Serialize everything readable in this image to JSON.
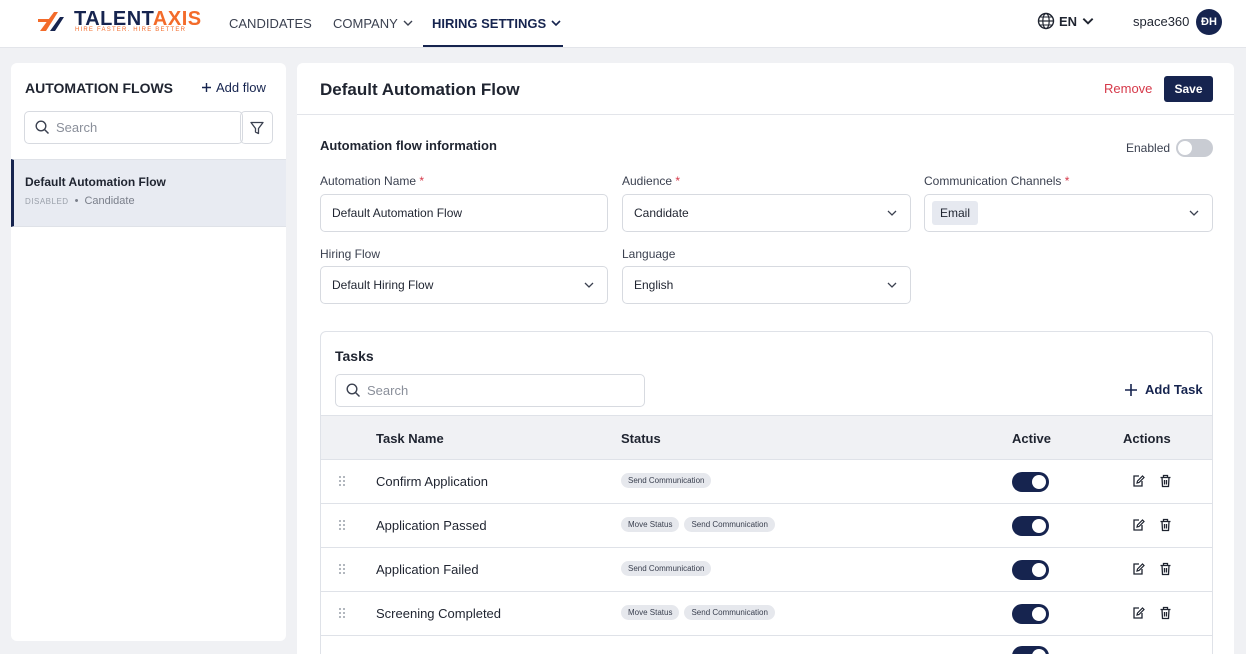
{
  "brand": {
    "name_dark": "TALENT",
    "name_accent": "AXIS",
    "tagline": "HIRE FASTER. HIRE BETTER"
  },
  "nav": {
    "items": [
      {
        "label": "CANDIDATES",
        "has_dropdown": false,
        "active": false
      },
      {
        "label": "COMPANY",
        "has_dropdown": true,
        "active": false
      },
      {
        "label": "HIRING SETTINGS",
        "has_dropdown": true,
        "active": true
      }
    ],
    "language": "EN",
    "username": "space360",
    "avatar_initials": "ĐH"
  },
  "sidebar": {
    "title": "AUTOMATION FLOWS",
    "add_label": "Add flow",
    "search_placeholder": "Search",
    "items": [
      {
        "title": "Default Automation Flow",
        "status": "DISABLED",
        "audience": "Candidate"
      }
    ]
  },
  "main": {
    "title": "Default Automation Flow",
    "remove_label": "Remove",
    "save_label": "Save",
    "section_title": "Automation flow information",
    "enabled_label": "Enabled",
    "enabled": false,
    "fields": {
      "automation_name": {
        "label": "Automation Name",
        "required": true,
        "value": "Default Automation Flow"
      },
      "audience": {
        "label": "Audience",
        "required": true,
        "value": "Candidate"
      },
      "channels": {
        "label": "Communication Channels",
        "required": true,
        "values": [
          "Email"
        ]
      },
      "hiring_flow": {
        "label": "Hiring Flow",
        "required": false,
        "value": "Default Hiring Flow"
      },
      "language": {
        "label": "Language",
        "required": false,
        "value": "English"
      }
    }
  },
  "tasks": {
    "title": "Tasks",
    "search_placeholder": "Search",
    "add_label": "Add Task",
    "columns": {
      "name": "Task Name",
      "status": "Status",
      "active": "Active",
      "actions": "Actions"
    },
    "rows": [
      {
        "name": "Confirm Application",
        "statuses": [
          "Send Communication"
        ],
        "active": true
      },
      {
        "name": "Application Passed",
        "statuses": [
          "Move Status",
          "Send Communication"
        ],
        "active": true
      },
      {
        "name": "Application Failed",
        "statuses": [
          "Send Communication"
        ],
        "active": true
      },
      {
        "name": "Screening Completed",
        "statuses": [
          "Move Status",
          "Send Communication"
        ],
        "active": true
      },
      {
        "name": "",
        "statuses": [],
        "active": true
      }
    ]
  },
  "colors": {
    "primary": "#16244f",
    "accent": "#f36b2a",
    "danger": "#d6394a"
  },
  "icons": [
    "search-icon",
    "filter-icon",
    "plus-icon",
    "chevron-down-icon",
    "globe-icon",
    "drag-handle-icon",
    "edit-icon",
    "trash-icon"
  ]
}
